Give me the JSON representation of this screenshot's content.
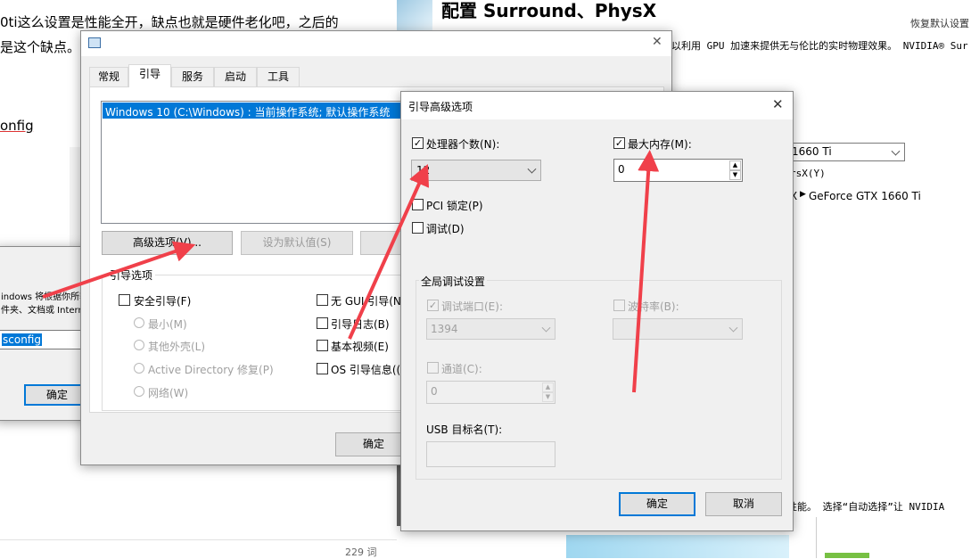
{
  "bg_left": {
    "line1": "0ti这么设置是性能全开，缺点也就是硬件老化吧，之后的",
    "line2": "是这个缺点。",
    "link": "onfig",
    "wordcount": "229 词"
  },
  "bg_right": {
    "title": "配置 Surround、PhysX",
    "restore": "恢复默认设置",
    "desc": "以利用 GPU 加速来提供无与伦比的实时物理效果。 NVIDIA® Sur",
    "select_value": "1660 Ti",
    "physx_label": "rsX(Y)",
    "gpu_prefix": "X",
    "gpu_name": "GeForce GTX 1660 Ti",
    "bottom_text": "性能。 选择“自动选择”让 NVIDIA"
  },
  "run_dialog": {
    "line1": "indows 将根据你所输",
    "line2": "件夹、文档或 Intern",
    "input_value": "sconfig",
    "ok": "确定"
  },
  "msconfig": {
    "tabs": [
      "常规",
      "引导",
      "服务",
      "启动",
      "工具"
    ],
    "boot_entry": "Windows 10 (C:\\Windows) : 当前操作系统; 默认操作系统",
    "advanced_btn": "高级选项(V)...",
    "default_btn": "设为默认值(S)",
    "group_title": "引导选项",
    "safe_boot": "安全引导(F)",
    "radios": [
      "最小(M)",
      "其他外壳(L)",
      "Active Directory 修复(P)",
      "网络(W)"
    ],
    "right_opts": [
      "无 GUI 引导(N",
      "引导日志(B)",
      "基本视频(E)",
      "OS 引导信息(("
    ],
    "ok": "确定"
  },
  "advanced": {
    "title": "引导高级选项",
    "cpu_label": "处理器个数(N):",
    "cpu_value": "12",
    "mem_label": "最大内存(M):",
    "mem_value": "0",
    "pci_label": "PCI 锁定(P)",
    "debug_label": "调试(D)",
    "global_title": "全局调试设置",
    "port_label": "调试端口(E):",
    "port_value": "1394",
    "baud_label": "波特率(B):",
    "channel_label": "通道(C):",
    "channel_value": "0",
    "usb_label": "USB 目标名(T):",
    "ok": "确定",
    "cancel": "取消"
  },
  "colors": {
    "selection": "#0078d7",
    "arrow": "#f0404a"
  }
}
